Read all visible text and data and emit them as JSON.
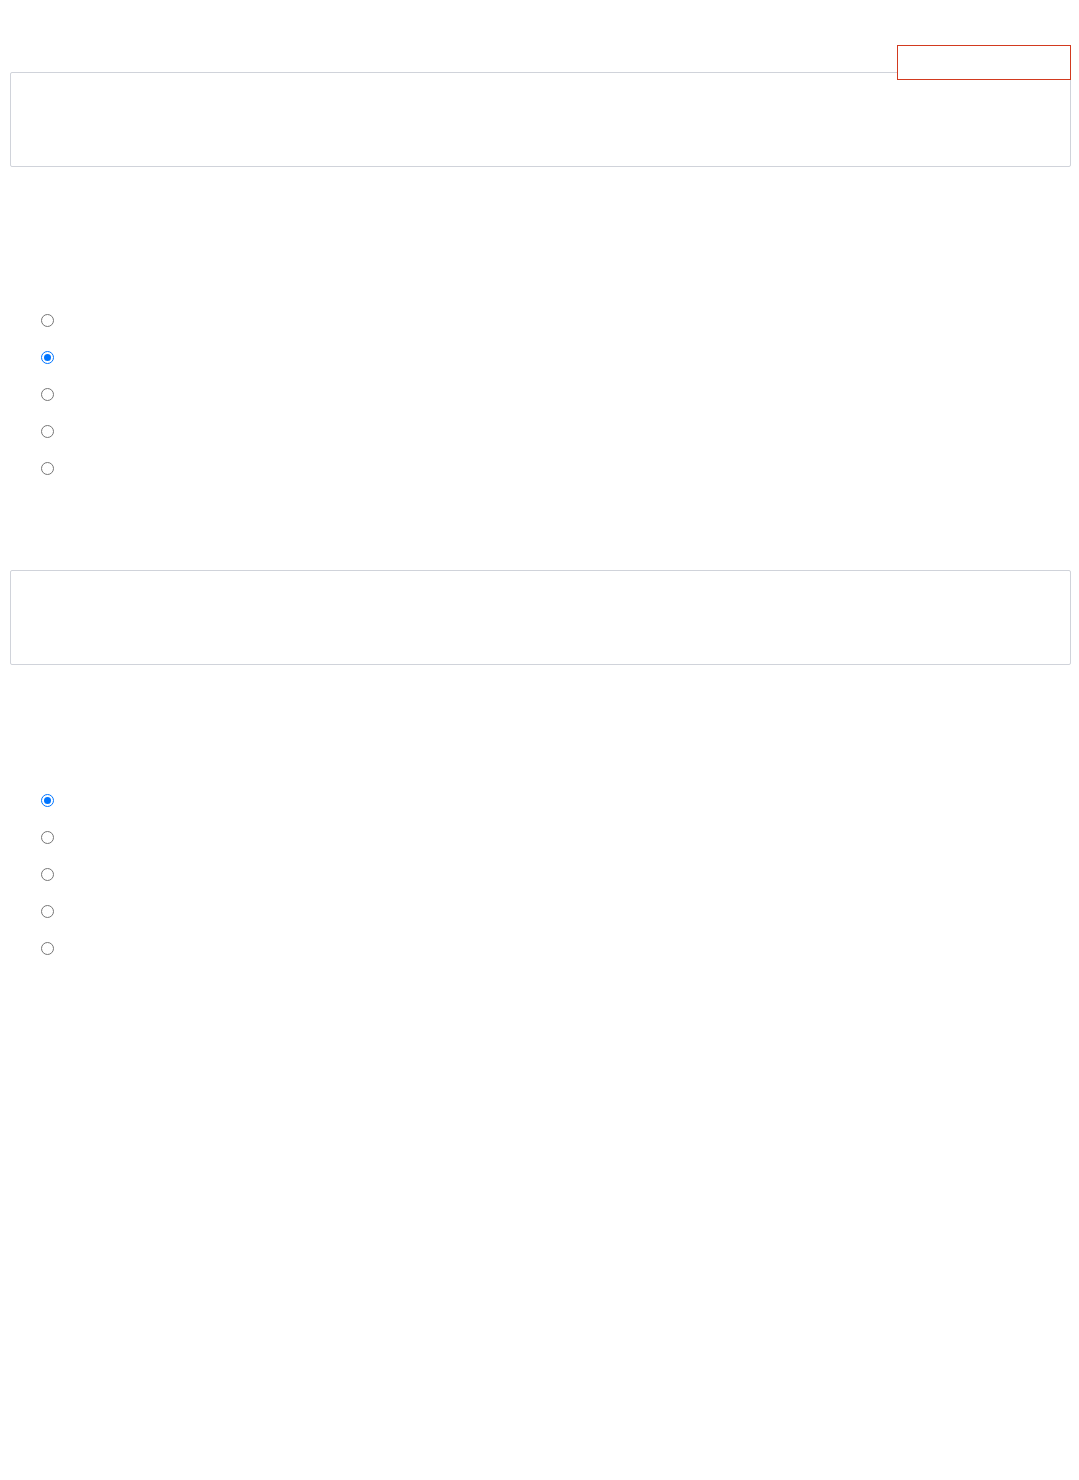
{
  "questions": [
    {
      "options": [
        {
          "selected": false
        },
        {
          "selected": true
        },
        {
          "selected": false
        },
        {
          "selected": false
        },
        {
          "selected": false
        }
      ]
    },
    {
      "options": [
        {
          "selected": true
        },
        {
          "selected": false
        },
        {
          "selected": false
        },
        {
          "selected": false
        },
        {
          "selected": false
        }
      ]
    }
  ]
}
